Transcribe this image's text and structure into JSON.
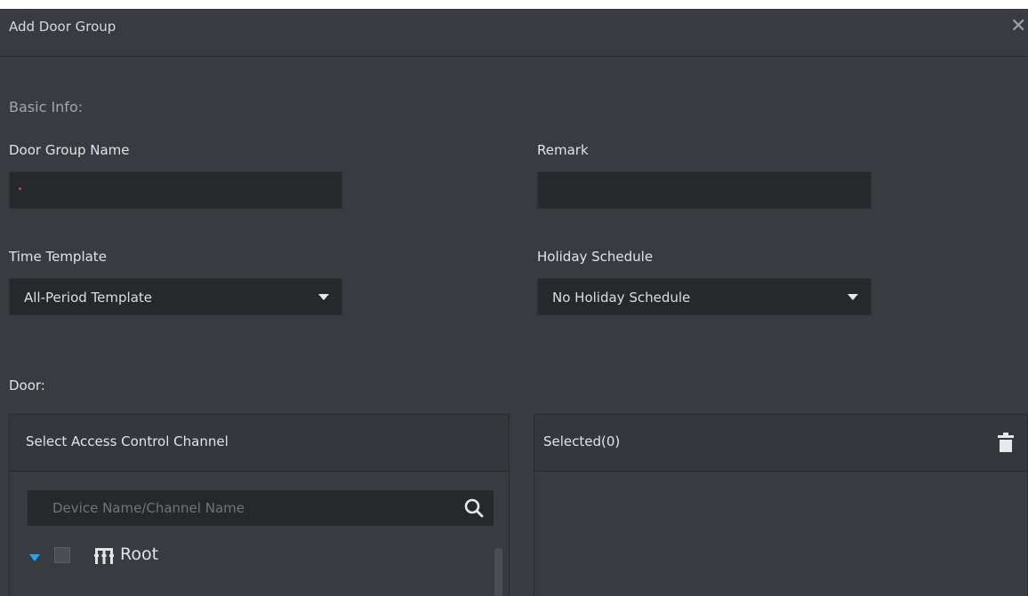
{
  "dialog": {
    "title": "Add Door Group"
  },
  "basic_info": {
    "section_label": "Basic Info:",
    "door_group_name": {
      "label": "Door Group Name",
      "value": "",
      "required": true
    },
    "remark": {
      "label": "Remark",
      "value": ""
    },
    "time_template": {
      "label": "Time Template",
      "selected": "All-Period Template"
    },
    "holiday_schedule": {
      "label": "Holiday Schedule",
      "selected": "No Holiday Schedule"
    }
  },
  "door": {
    "section_label": "Door:",
    "left_panel": {
      "title": "Select Access Control Channel",
      "search_placeholder": "Device Name/Channel Name",
      "tree": [
        {
          "label": "Root",
          "expanded": true,
          "checked": false
        }
      ]
    },
    "right_panel": {
      "title": "Selected(0)"
    }
  },
  "icons": {
    "close": "close-icon",
    "search": "search-icon",
    "expand": "triangle-down-icon",
    "org": "organization-icon",
    "delete": "trash-icon",
    "dropdown": "caret-down-icon"
  },
  "colors": {
    "dialog_bg": "#383b40",
    "input_bg": "#26282c",
    "accent_blue": "#2aa6ea",
    "required_red": "#e53935"
  }
}
